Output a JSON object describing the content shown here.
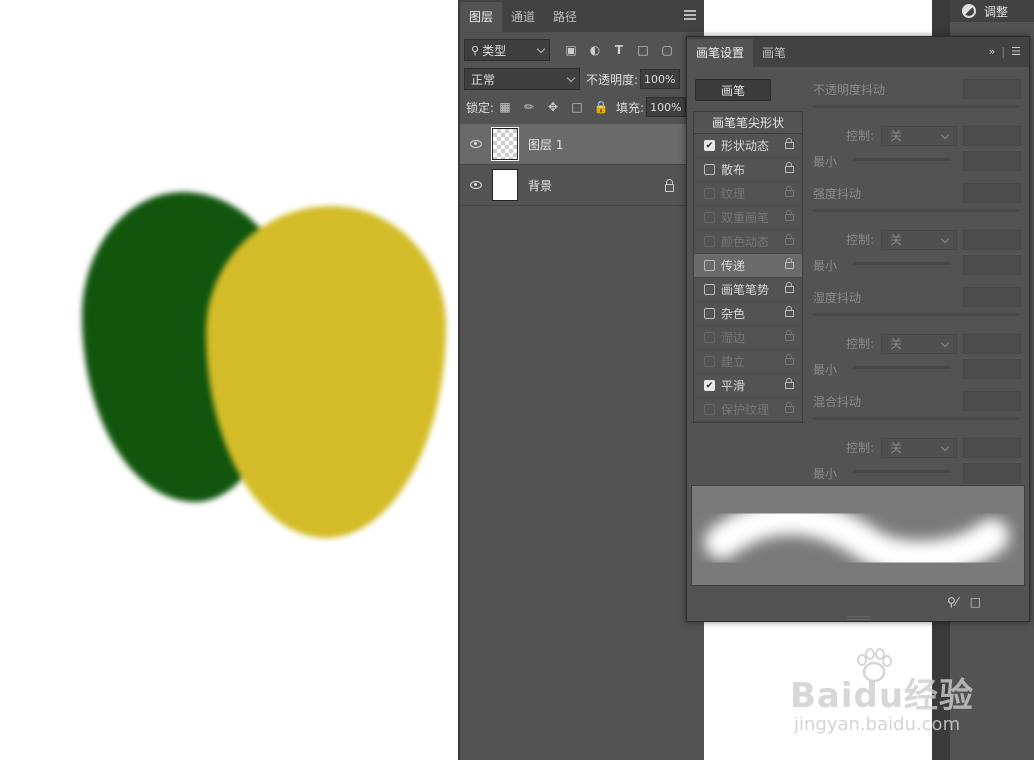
{
  "layers_panel": {
    "tabs": [
      {
        "label": "图层",
        "active": true
      },
      {
        "label": "通道",
        "active": false
      },
      {
        "label": "路径",
        "active": false
      }
    ],
    "filter_kind": "类型",
    "blend_mode": "正常",
    "opacity_label": "不透明度:",
    "opacity_value": "100%",
    "lock_label": "锁定:",
    "fill_label": "填充:",
    "fill_value": "100%",
    "layers": [
      {
        "name": "图层 1",
        "selected": true,
        "visible": true,
        "locked": false
      },
      {
        "name": "背景",
        "selected": false,
        "visible": true,
        "locked": true
      }
    ]
  },
  "adjust_panel": {
    "title": "调整"
  },
  "brush_panel": {
    "tabs": [
      {
        "label": "画笔设置",
        "active": true
      },
      {
        "label": "画笔",
        "active": false
      }
    ],
    "brush_button": "画笔",
    "list_header": "画笔笔尖形状",
    "options": [
      {
        "label": "形状动态",
        "checked": true,
        "enabled": true,
        "highlighted": false
      },
      {
        "label": "散布",
        "checked": false,
        "enabled": true,
        "highlighted": false
      },
      {
        "label": "纹理",
        "checked": false,
        "enabled": false,
        "highlighted": false
      },
      {
        "label": "双重画笔",
        "checked": false,
        "enabled": false,
        "highlighted": false
      },
      {
        "label": "颜色动态",
        "checked": false,
        "enabled": false,
        "highlighted": false
      },
      {
        "label": "传递",
        "checked": false,
        "enabled": true,
        "highlighted": true
      },
      {
        "label": "画笔笔势",
        "checked": false,
        "enabled": true,
        "highlighted": false
      },
      {
        "label": "杂色",
        "checked": false,
        "enabled": true,
        "highlighted": false
      },
      {
        "label": "湿边",
        "checked": false,
        "enabled": false,
        "highlighted": false
      },
      {
        "label": "建立",
        "checked": false,
        "enabled": false,
        "highlighted": false
      },
      {
        "label": "平滑",
        "checked": true,
        "enabled": true,
        "highlighted": false
      },
      {
        "label": "保护纹理",
        "checked": false,
        "enabled": false,
        "highlighted": false
      }
    ],
    "props": {
      "opacity_jitter": "不透明度抖动",
      "control_label": "控制:",
      "control_value": "关",
      "minimum_label": "最小",
      "strength_jitter": "强度抖动",
      "wetness_jitter": "湿度抖动",
      "mix_jitter": "混合抖动"
    }
  },
  "watermark": {
    "main": "Baidu经验",
    "sub": "jingyan.baidu.com"
  },
  "colors": {
    "green_paint": "#12560e",
    "yellow_paint": "#d3bc27",
    "panel_bg": "#535353"
  }
}
